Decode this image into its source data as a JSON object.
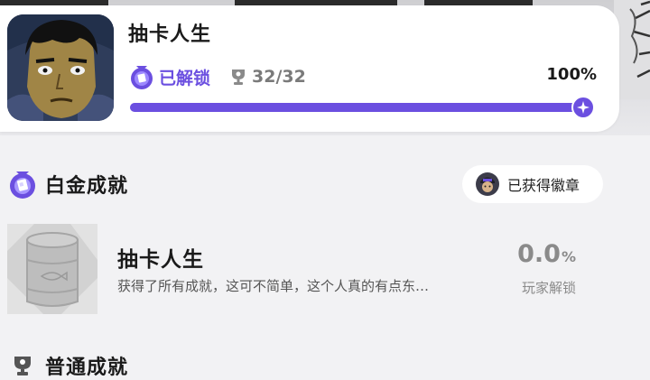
{
  "game": {
    "title": "抽卡人生",
    "unlock_status": "已解锁",
    "trophy_count": "32/32",
    "progress_percent": "100%",
    "progress_value": 1.0
  },
  "platinum_section": {
    "title": "白金成就",
    "badge_button_label": "已获得徽章"
  },
  "achievement": {
    "title": "抽卡人生",
    "description": "获得了所有成就，这可不简单，这个人真的有点东…",
    "rate_value": "0.0",
    "rate_unit": "%",
    "rate_label": "玩家解锁"
  },
  "normal_section": {
    "title": "普通成就"
  },
  "colors": {
    "accent": "#6b4fe0",
    "muted": "#8a8a8a",
    "background": "#f2f2f4"
  }
}
